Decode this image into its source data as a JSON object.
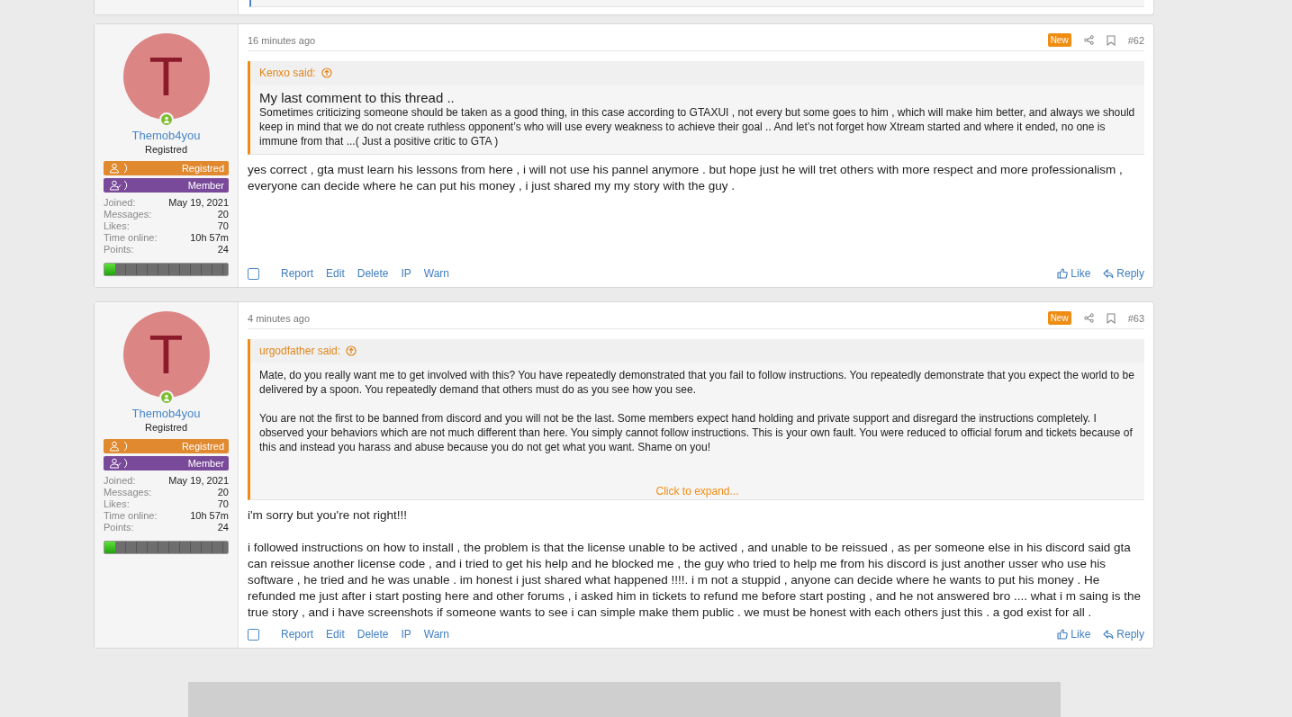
{
  "posts": [
    {
      "user": {
        "initial": "T",
        "name": "Themob4you",
        "online": true,
        "title": "Registred",
        "banners": [
          {
            "kind": "user",
            "label": "Registred",
            "color": "#e0892f"
          },
          {
            "kind": "user-check",
            "label": "Member",
            "color": "#7a4a9a"
          }
        ],
        "stats": [
          {
            "label": "Joined:",
            "value": "May 19, 2021"
          },
          {
            "label": "Messages:",
            "value": "20"
          },
          {
            "label": "Likes:",
            "value": "70"
          },
          {
            "label": "Time online:",
            "value": "10h 57m"
          },
          {
            "label": "Points:",
            "value": "24"
          }
        ],
        "level": 0.09
      },
      "time": "16 minutes ago",
      "badge": "New",
      "number": "#62",
      "quote": {
        "author": "Kenxo said:",
        "heading": "My last comment to this thread ..",
        "paragraphs": [
          "Sometimes criticizing someone should be taken as a good thing, in this case according to GTAXUI , not every but some goes to him , which will make him better, and always we should keep in mind that we do not create ruthless opponent’s who will use every weakness to achieve their goal .. And let’s not forget how Xtream started and where it ended, no one is immune from that ...( Just a positive critic to GTA )"
        ]
      },
      "body": [
        "yes correct , gta must learn his lessons from here , i will not use his pannel anymore . but hope just he will tret others with more respect and more professionalism , everyone can decide where he can put his money , i just shared my my story with the guy ."
      ],
      "checked": false,
      "actions": [
        "Report",
        "Edit",
        "Delete",
        "IP",
        "Warn"
      ],
      "like": "Like",
      "reply": "Reply"
    },
    {
      "user": {
        "initial": "T",
        "name": "Themob4you",
        "online": true,
        "title": "Registred",
        "banners": [
          {
            "kind": "user",
            "label": "Registred",
            "color": "#e0892f"
          },
          {
            "kind": "user-check",
            "label": "Member",
            "color": "#7a4a9a"
          }
        ],
        "stats": [
          {
            "label": "Joined:",
            "value": "May 19, 2021"
          },
          {
            "label": "Messages:",
            "value": "20"
          },
          {
            "label": "Likes:",
            "value": "70"
          },
          {
            "label": "Time online:",
            "value": "10h 57m"
          },
          {
            "label": "Points:",
            "value": "24"
          }
        ],
        "level": 0.09
      },
      "time": "4 minutes ago",
      "badge": "New",
      "number": "#63",
      "quote": {
        "author": "urgodfather said:",
        "paragraphs": [
          "Mate, do you really want me to get involved with this? You have repeatedly demonstrated that you fail to follow instructions. You repeatedly demonstrate that you expect the world to be delivered by a spoon. You repeatedly demand that others must do as you see how you see.",
          "You are not the first to be banned from discord and you will not be the last. Some members expect hand holding and private support and disregard the instructions completely. I observed your behaviors which are not much different than here. You simply cannot follow instructions. This is your own fault. You were reduced to official forum and tickets because of this and instead you harass and abuse because you do not get what you want. Shame on you!"
        ],
        "expand": "Click to expand..."
      },
      "body": [
        "i'm sorry but you're not right!!!",
        "i followed instructions on how to install , the problem is that the license unable to be actived , and unable to be reissued , as per someone else in his discord said gta can reissue another license code , and i tried to get his help and he blocked me , the guy who tried to help me from his discord is just another usser who use his software , he tried and he was unable . im honest i just shared what happened !!!!. i m not a stuppid , anyone can decide where he wants to put his money . He refunded me just after i start posting here and other forums , i asked him in tickets to refund me before start posting , and he not answered bro .... what i m saing is the true story , and i have screenshots if someone wants to see i can simple make them public . we must be honest with each others just this . a god exist for all ."
      ],
      "checked": false,
      "actions": [
        "Report",
        "Edit",
        "Delete",
        "IP",
        "Warn"
      ],
      "like": "Like",
      "reply": "Reply"
    }
  ]
}
